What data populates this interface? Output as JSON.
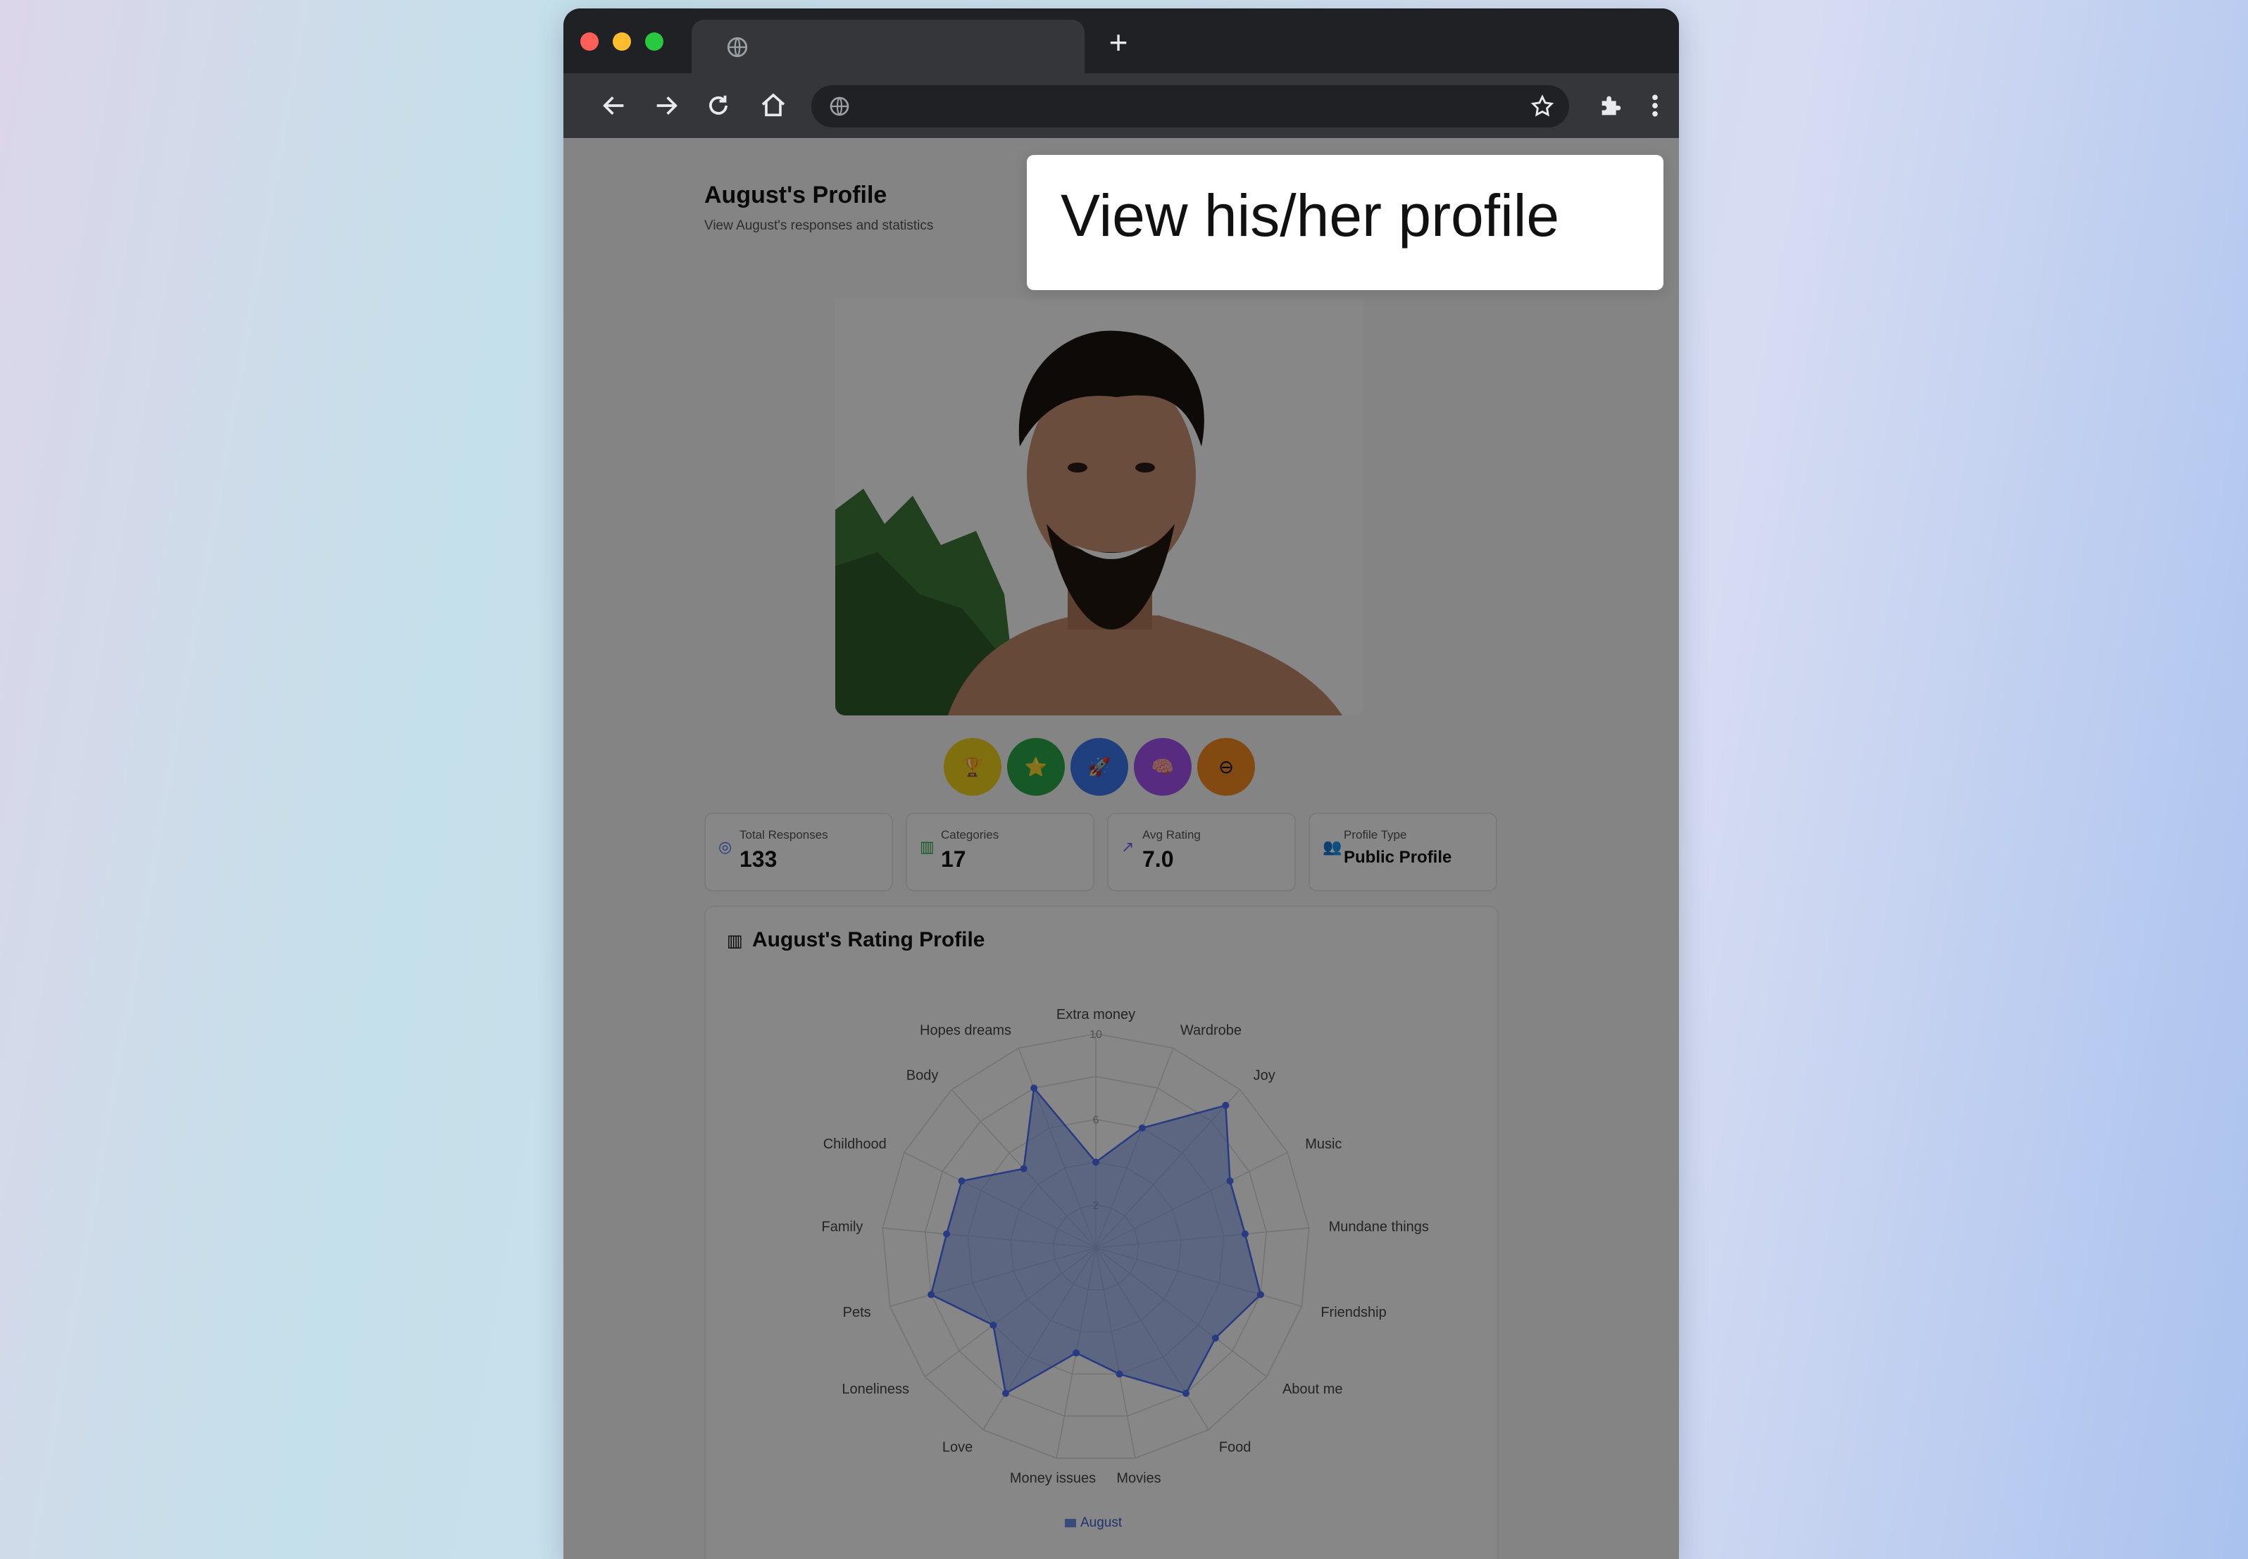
{
  "browser": {
    "new_tab_symbol": "+",
    "icons": [
      "globe-icon",
      "back-arrow-icon",
      "forward-arrow-icon",
      "reload-icon",
      "home-icon",
      "star-icon",
      "puzzle-icon",
      "kebab-menu-icon"
    ],
    "colors": {
      "close": "#ff5f57",
      "minimize": "#febc2e",
      "maximize": "#28c840"
    }
  },
  "profile": {
    "title": "August's Profile",
    "subtitle": "View August's responses and statistics"
  },
  "callout": {
    "text": "View his/her profile"
  },
  "badges": [
    {
      "icon": "trophy-icon",
      "glyph": "🏆",
      "color": "#f1d21b"
    },
    {
      "icon": "star-icon",
      "glyph": "⭐",
      "color": "#2aa84a"
    },
    {
      "icon": "rocket-icon",
      "glyph": "🚀",
      "color": "#3c78f0"
    },
    {
      "icon": "brain-icon",
      "glyph": "🧠",
      "color": "#a252f2"
    },
    {
      "icon": "minus-icon",
      "glyph": "⊖",
      "color": "#f58a1f"
    }
  ],
  "stats": [
    {
      "label": "Total Responses",
      "value": "133",
      "icon": "target-icon",
      "glyph": "◎",
      "color": "#4a6ef5"
    },
    {
      "label": "Categories",
      "value": "17",
      "icon": "bar-chart-icon",
      "glyph": "▥",
      "color": "#2aa84a"
    },
    {
      "label": "Avg Rating",
      "value": "7.0",
      "icon": "trend-icon",
      "glyph": "↗",
      "color": "#8a5cf5"
    },
    {
      "label": "Profile Type",
      "value": "Public Profile",
      "icon": "users-icon",
      "glyph": "👥",
      "color": "#e8663c"
    }
  ],
  "chart_title": "August's Rating Profile",
  "chart_data": {
    "type": "radar",
    "title": "August's Rating Profile",
    "categories": [
      "Extra money",
      "Wardrobe",
      "Joy",
      "Music",
      "Mundane things",
      "Friendship",
      "About me",
      "Food",
      "Movies",
      "Money issues",
      "Love",
      "Loneliness",
      "Pets",
      "Family",
      "Childhood",
      "Body",
      "Hopes dreams"
    ],
    "series": [
      {
        "name": "August",
        "values": [
          4,
          6,
          9,
          7,
          7,
          8,
          7,
          8,
          6,
          5,
          8,
          6,
          8,
          7,
          7,
          5,
          8
        ]
      }
    ],
    "rlim": [
      0,
      10
    ],
    "radial_ticks": [
      2,
      6,
      10
    ],
    "grid": true,
    "legend": "bottom",
    "color": "#6d8ee8"
  }
}
